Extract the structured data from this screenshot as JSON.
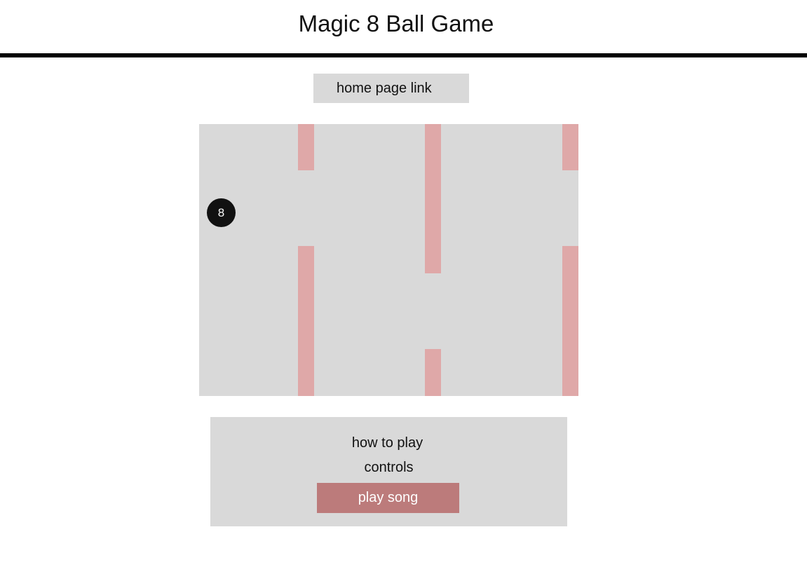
{
  "header": {
    "title": "Magic 8 Ball Game"
  },
  "nav": {
    "home_link_label": "home page link"
  },
  "game": {
    "ball_label": "8",
    "pipe_color": "#dfa8a8",
    "board_color": "#d9d9d9",
    "ball_color": "#111111"
  },
  "panel": {
    "how_to_play_label": "how to play",
    "controls_label": "controls",
    "play_song_label": "play song",
    "play_song_color": "#bc7b7b"
  }
}
